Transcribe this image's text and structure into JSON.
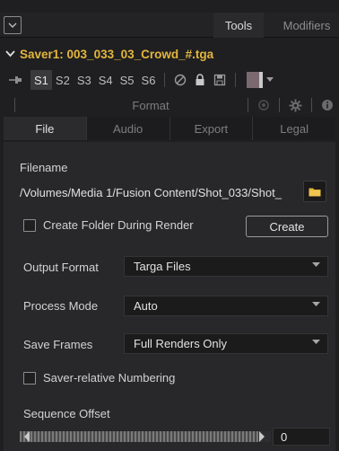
{
  "tabs": {
    "tools_label": "Tools",
    "modifiers_label": "Modifiers"
  },
  "node": {
    "title": "Saver1: 003_033_03_Crowd_#.tga",
    "title_color": "#e4b63c"
  },
  "versions": [
    "S1",
    "S2",
    "S3",
    "S4",
    "S5",
    "S6"
  ],
  "active_version": "S1",
  "toolbar_icons": [
    "pin-icon",
    "disable-icon",
    "lock-icon",
    "cache-icon",
    "color-swatch",
    "dropdown-arrow-icon"
  ],
  "format_section": {
    "label": "Format",
    "icons": [
      "view-icon",
      "gear-icon",
      "info-icon"
    ]
  },
  "subtabs": [
    {
      "label": "File",
      "active": true
    },
    {
      "label": "Audio",
      "active": false
    },
    {
      "label": "Export",
      "active": false
    },
    {
      "label": "Legal",
      "active": false
    }
  ],
  "file": {
    "filename_label": "Filename",
    "filename_value": "/Volumes/Media 1/Fusion Content/Shot_033/Shot_",
    "create_folder_label": "Create Folder During Render",
    "create_folder_checked": false,
    "create_button_label": "Create",
    "output_format_label": "Output Format",
    "output_format_value": "Targa Files",
    "process_mode_label": "Process Mode",
    "process_mode_value": "Auto",
    "save_frames_label": "Save Frames",
    "save_frames_value": "Full Renders Only",
    "saver_numbering_label": "Saver-relative Numbering",
    "saver_numbering_checked": false,
    "sequence_offset_label": "Sequence Offset",
    "sequence_offset_value": "0",
    "sequence_offset_fill": 0.95
  }
}
